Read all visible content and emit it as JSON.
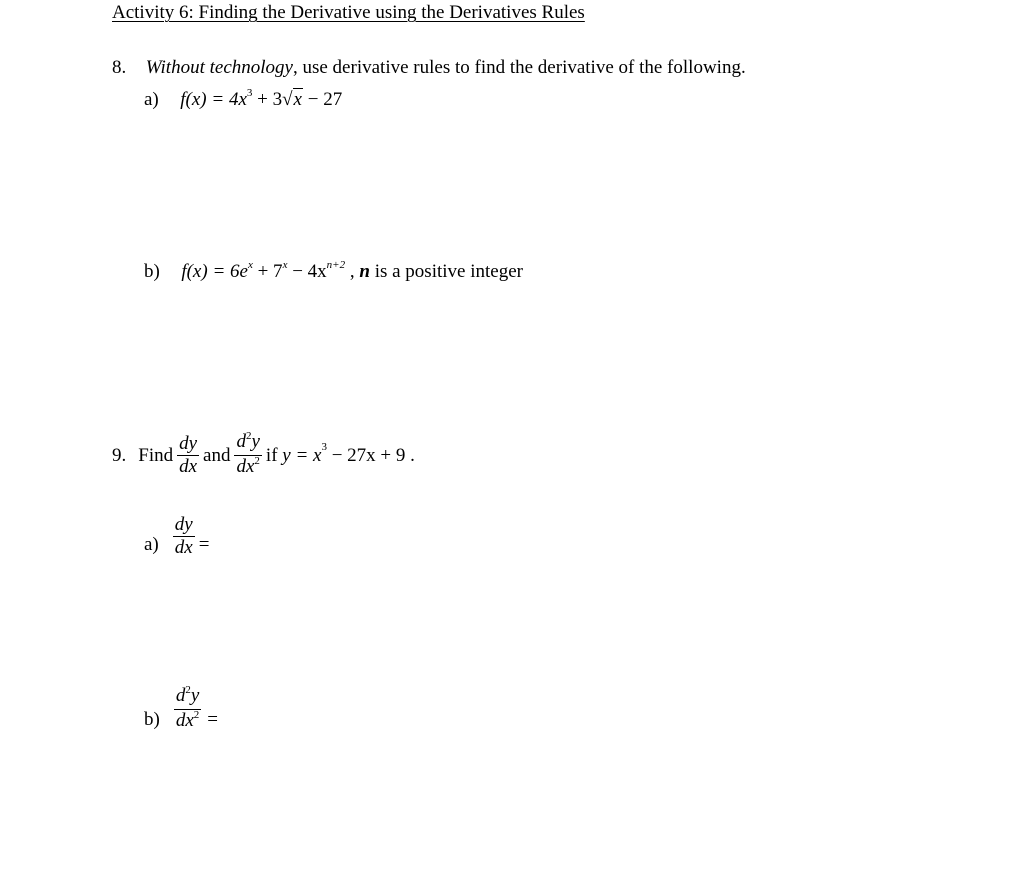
{
  "title": "Activity 6:  Finding the Derivative using the Derivatives Rules",
  "q8": {
    "number": "8.",
    "instruction_italic": "Without technology",
    "instruction_rest": ", use derivative rules to find the derivative of the following.",
    "a": {
      "label": "a)",
      "lhs": "f(x) = 4x",
      "exp1": "3",
      "mid": " + 3",
      "radicand": "x",
      "tail": " − 27"
    },
    "b": {
      "label": "b)",
      "lhs": "f(x) = 6e",
      "exp1": "x",
      "plus7": " + 7",
      "exp2": "x",
      "minus4x": " − 4x",
      "exp3": "n+2",
      "comma": " , ",
      "n": "n",
      "note": " is a positive integer"
    }
  },
  "q9": {
    "number": "9.",
    "find": "Find",
    "frac1_num": "dy",
    "frac1_den": "dx",
    "and": "and",
    "frac2_num_d": "d",
    "frac2_num_exp": "2",
    "frac2_num_y": "y",
    "frac2_den_dx": "dx",
    "frac2_den_exp": "2",
    "cond_if": "if ",
    "cond_expr": "y = x",
    "cond_exp": "3",
    "cond_tail": " − 27x + 9 .",
    "a": {
      "label": "a)",
      "num": "dy",
      "den": "dx",
      "eq": "="
    },
    "b": {
      "label": "b)",
      "num_d": "d",
      "num_exp": "2",
      "num_y": "y",
      "den_dx": "dx",
      "den_exp": "2",
      "eq": "="
    }
  }
}
